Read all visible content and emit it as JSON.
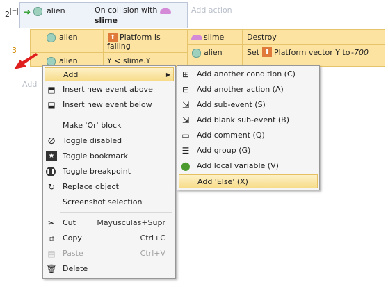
{
  "events": {
    "row_number": "2",
    "collapse_glyph": "⊟",
    "event1": {
      "condition_object": "alien",
      "description_line1": "On collision with",
      "description_line2": "slime",
      "add_action": "Add action"
    },
    "sub_event": {
      "row_number": "3",
      "cond1_object": "alien",
      "cond1_text_a": "Platform is",
      "cond1_text_b": "falling",
      "cond2_object": "alien",
      "cond2_text": "Y < slime.Y",
      "action1_object": "slime",
      "action1_text": "Destroy",
      "action2_object": "alien",
      "action2_text_a": "Set",
      "action2_text_b": "Platform vector Y to",
      "action2_value": "-700"
    },
    "left_add": "Add"
  },
  "context_menu": {
    "add": "Add",
    "insert_above": "Insert new event above",
    "insert_below": "Insert new event below",
    "make_or": "Make 'Or' block",
    "toggle_disabled": "Toggle disabled",
    "toggle_bookmark": "Toggle bookmark",
    "toggle_breakpoint": "Toggle breakpoint",
    "replace_object": "Replace object",
    "screenshot_selection": "Screenshot selection",
    "cut": "Cut",
    "cut_shortcut": "Mayusculas+Supr",
    "copy": "Copy",
    "copy_shortcut": "Ctrl+C",
    "paste": "Paste",
    "paste_shortcut": "Ctrl+V",
    "delete": "Delete"
  },
  "add_submenu": {
    "another_condition": "Add another condition (C)",
    "another_action": "Add another action (A)",
    "sub_event": "Add sub-event (S)",
    "blank_sub_event": "Add blank sub-event (B)",
    "comment": "Add comment (Q)",
    "group": "Add group (G)",
    "local_variable": "Add local variable (V)",
    "else": "Add 'Else' (X)"
  },
  "icons": {
    "alien": "alien-icon",
    "slime": "slime-icon",
    "platform": "platform-behavior-icon",
    "arrow": "green-arrow-icon",
    "pointer": "red-arrow-icon"
  },
  "colors": {
    "selection": "#fde3a2",
    "highlight": "#f7dc8a",
    "event_bg": "#eef2f9",
    "pointer": "#e01e1e"
  }
}
